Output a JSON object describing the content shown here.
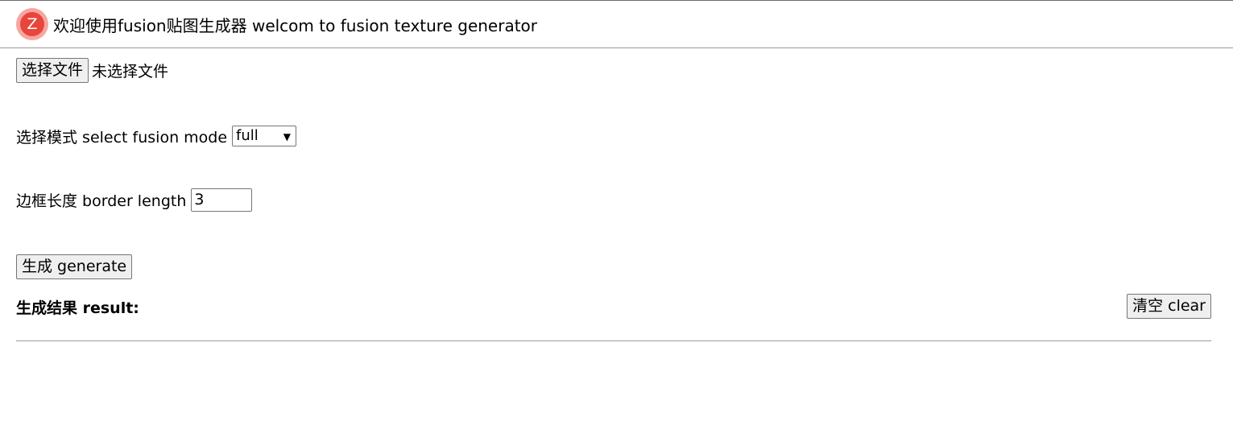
{
  "header": {
    "logo_letter": "Z",
    "title": "欢迎使用fusion贴图生成器 welcom to fusion texture generator"
  },
  "file": {
    "button_label": "选择文件",
    "status": "未选择文件"
  },
  "mode": {
    "label": "选择模式 select fusion mode",
    "selected": "full"
  },
  "border": {
    "label": "边框长度 border length",
    "value": "3"
  },
  "generate": {
    "button_label": "生成 generate"
  },
  "result": {
    "label": "生成结果 result:",
    "clear_label": "清空 clear"
  },
  "colors": {
    "logo_outer": "#f7a6a0",
    "logo_inner": "#e8453c",
    "button_bg": "#efefef",
    "rule": "#9a9a9a"
  }
}
